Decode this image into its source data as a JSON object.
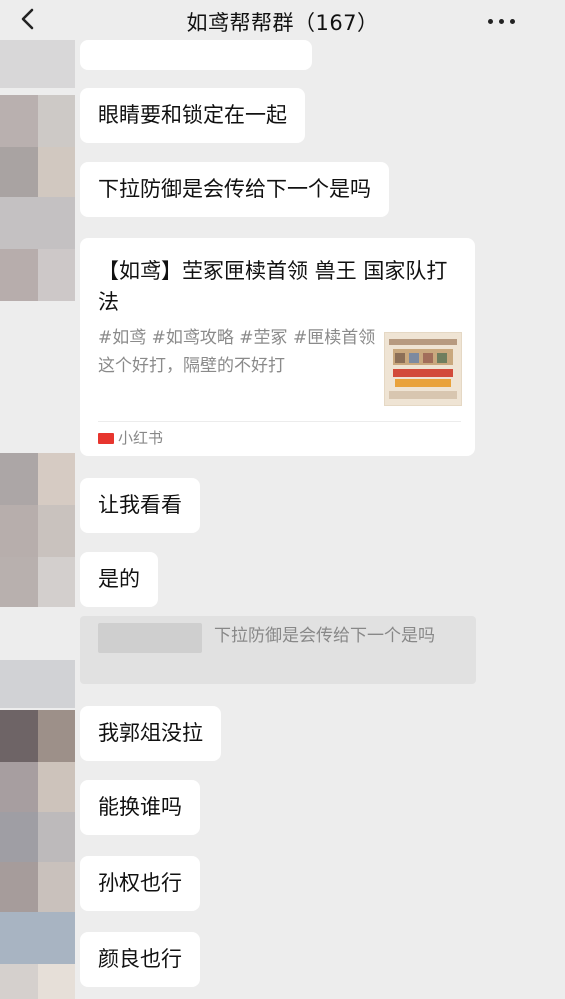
{
  "header": {
    "back_icon": "chevron-left-icon",
    "title": "如鸢帮帮群（167）",
    "more_icon": "more-dots-icon"
  },
  "messages": [
    {
      "text": "眼睛要和锁定在一起"
    },
    {
      "text": "下拉防御是会传给下一个是吗"
    },
    {
      "text": "让我看看"
    },
    {
      "text": "是的"
    },
    {
      "text": "我郭俎没拉"
    },
    {
      "text": "能换谁吗"
    },
    {
      "text": "孙权也行"
    },
    {
      "text": "颜良也行"
    }
  ],
  "share_card": {
    "title": "【如鸢】茔冢匣椟首领 兽王 国家队打法",
    "description": "#如鸢 #如鸢攻略 #茔冢 #匣椟首领 这个好打，隔壁的不好打",
    "source": "小红书",
    "source_color": "#e7352e"
  },
  "quote": {
    "text": "下拉防御是会传给下一个是吗"
  },
  "colors": {
    "background": "#ededed",
    "bubble": "#ffffff",
    "quote_bg": "#e1e1e1"
  }
}
